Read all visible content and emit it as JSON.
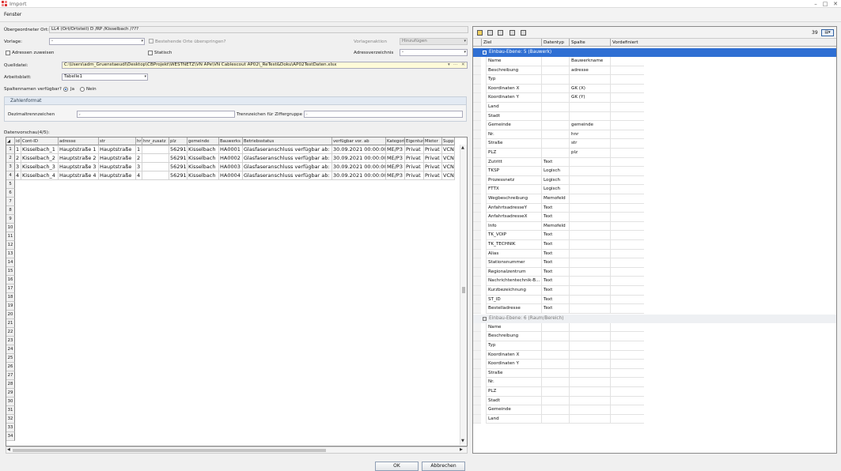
{
  "window": {
    "title": "Import",
    "min": "–",
    "max": "□",
    "close": "✕"
  },
  "menu": {
    "fenster": "Fenster"
  },
  "form": {
    "ort_label": "Übergeordneter Ort:",
    "ort_value": "LL4 (Ort/Ortsteil) D /RP /Kisselbach /???",
    "vorlage_label": "Vorlage:",
    "vorlage_value": "-",
    "bestehende_label": "Bestehende Orte überspringen?",
    "vorlagenaktion_label": "Vorlagenaktion",
    "vorlagenaktion_value": "Hinzufügen",
    "adressen_label": "Adressen zuweisen",
    "statisch_label": "Statisch",
    "adressverzeichnis_label": "Adressverzeichnis",
    "adressverzeichnis_value": "-",
    "quelldatei_label": "Quelldatei:",
    "quelldatei_value": "C:\\Users\\adm_Gruenstaeudl\\Desktop\\CBProjekt\\WESTNETZ\\VN APe\\VN Cablescout AP02\\_ReTest&Doku\\AP02TestDaten.xlsx",
    "arbeitsblatt_label": "Arbeitsblatt:",
    "arbeitsblatt_value": "Tabelle1",
    "spaltennamen_label": "Spaltennamen verfügbar?",
    "ja": "Ja",
    "nein": "Nein",
    "zahlenformat_label": "Zahlenformat",
    "dezimal_label": "Dezimaltrennzeichen",
    "dezimal_value": ",",
    "trenn_label": "Trennzeichen für Ziffergruppe",
    "trenn_value": ".",
    "vorschau_label": "Datenvorschau(4/5):"
  },
  "grid": {
    "columns": [
      "id",
      "Cont-ID",
      "adresse",
      "str",
      "hr",
      "hnr_zusatz",
      "plz",
      "gemeinde",
      "Bauwerks",
      "Betriebsstatus",
      "verfügbar vor. ab",
      "Kategorie",
      "Eigentum",
      "Mieter",
      "Supp"
    ],
    "rows": [
      [
        "1",
        "Kisselbach_1",
        "Hauptstraße 1",
        "Hauptstraße",
        "1",
        "",
        "56291",
        "Kisselbach",
        "HA0001",
        "Glasfaseranschluss verfügbar ab:",
        "30.09.2021 00:00:00",
        "ME/P3",
        "Privat",
        "Privat",
        "VCN"
      ],
      [
        "2",
        "Kisselbach_2",
        "Hauptstraße 2",
        "Hauptstraße",
        "2",
        "",
        "56291",
        "Kisselbach",
        "HA0002",
        "Glasfaseranschluss verfügbar ab:",
        "30.09.2021 00:00:00",
        "ME/P3",
        "Privat",
        "Privat",
        "VCN"
      ],
      [
        "3",
        "Kisselbach_3",
        "Hauptstraße 3",
        "Hauptstraße",
        "3",
        "",
        "56291",
        "Kisselbach",
        "HA0003",
        "Glasfaseranschluss verfügbar ab:",
        "30.09.2021 00:00:00",
        "ME/P3",
        "Privat",
        "Privat",
        "VCN"
      ],
      [
        "4",
        "Kisselbach_4",
        "Hauptstraße 4",
        "Hauptstraße",
        "4",
        "",
        "56291",
        "Kisselbach",
        "HA0004",
        "Glasfaseranschluss verfügbar ab:",
        "30.09.2021 00:00:00",
        "ME/P3",
        "Privat",
        "Privat",
        "VCN"
      ]
    ],
    "row_count": 34
  },
  "right": {
    "count": "39",
    "headers": [
      "Ziel",
      "Datentyp",
      "Spalte",
      "Vordefiniert"
    ],
    "group1": "Einbau-Ebene: 5 (Bauwerk)",
    "group1_rows": [
      [
        "Name",
        "",
        "Bauwerkname"
      ],
      [
        "Beschreibung",
        "",
        "adresse"
      ],
      [
        "Typ",
        "",
        ""
      ],
      [
        "Koordinaten X",
        "",
        "GK (X)"
      ],
      [
        "Koordinaten Y",
        "",
        "GK (Y)"
      ],
      [
        "Land",
        "",
        ""
      ],
      [
        "Stadt",
        "",
        ""
      ],
      [
        "Gemeinde",
        "",
        "gemeinde"
      ],
      [
        "Nr.",
        "",
        "hnr"
      ],
      [
        "Straße",
        "",
        "str"
      ],
      [
        "PLZ",
        "",
        "plz"
      ],
      [
        "Zutritt",
        "Text",
        ""
      ],
      [
        "TKSP",
        "Logisch",
        ""
      ],
      [
        "Prozessnetz",
        "Logisch",
        ""
      ],
      [
        "FTTX",
        "Logisch",
        ""
      ],
      [
        "Wegbeschreibung",
        "Memofeld",
        ""
      ],
      [
        "AnfahrtsadresseY",
        "Text",
        ""
      ],
      [
        "AnfahrtsadresseX",
        "Text",
        ""
      ],
      [
        "Info",
        "Memofeld",
        ""
      ],
      [
        "TK_VOIP",
        "Text",
        ""
      ],
      [
        "TK_TECHNIK",
        "Text",
        ""
      ],
      [
        "Alias",
        "Text",
        ""
      ],
      [
        "Stationsnummer",
        "Text",
        ""
      ],
      [
        "Regionalzentrum",
        "Text",
        ""
      ],
      [
        "Nachrichtentechnik-B...",
        "Text",
        ""
      ],
      [
        "Kurzbezeichnung",
        "Text",
        ""
      ],
      [
        "ST_ID",
        "Text",
        ""
      ],
      [
        "Bestelladresse",
        "Text",
        ""
      ]
    ],
    "group2": "Einbau-Ebene: 6 (Raum/Bereich)",
    "group2_rows": [
      [
        "Name",
        "",
        ""
      ],
      [
        "Beschreibung",
        "",
        ""
      ],
      [
        "Typ",
        "",
        ""
      ],
      [
        "Koordinaten X",
        "",
        ""
      ],
      [
        "Koordinaten Y",
        "",
        ""
      ],
      [
        "Straße",
        "",
        ""
      ],
      [
        "Nr.",
        "",
        ""
      ],
      [
        "PLZ",
        "",
        ""
      ],
      [
        "Stadt",
        "",
        ""
      ],
      [
        "Gemeinde",
        "",
        ""
      ],
      [
        "Land",
        "",
        ""
      ]
    ]
  },
  "buttons": {
    "ok": "OK",
    "abbrechen": "Abbrechen"
  },
  "colors": {
    "selection": "#2f6fd3",
    "file_bg": "#fffbd8"
  }
}
